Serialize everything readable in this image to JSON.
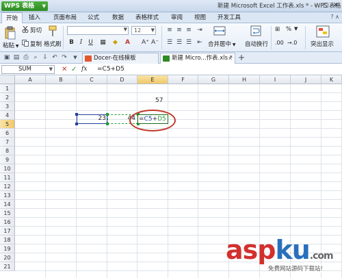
{
  "app": {
    "logo": "WPS 表格",
    "window_title": "新建 Microsoft Excel 工作表.xls * - WPS 表格"
  },
  "menu": {
    "tabs": [
      "开始",
      "插入",
      "页面布局",
      "公式",
      "数据",
      "表格样式",
      "审阅",
      "视图",
      "开发工具"
    ]
  },
  "ribbon": {
    "paste": "粘贴",
    "cut": "剪切",
    "copy": "复制",
    "format_painter": "格式刷",
    "font_size": "12",
    "merge_center": "合并居中",
    "wrap_text": "自动换行",
    "percent": "%",
    "highlight": "突出显示"
  },
  "tabs": {
    "docer": "Docer-在线模板",
    "workbook": "新建 Micro...作表.xls *"
  },
  "formula_bar": {
    "name_box": "SUM",
    "cancel": "✕",
    "confirm": "✓",
    "fx": "fx",
    "formula": "=C5+D5"
  },
  "sheet": {
    "columns": [
      "A",
      "B",
      "C",
      "D",
      "E",
      "F",
      "G",
      "H",
      "I",
      "J",
      "K"
    ],
    "rows": [
      "1",
      "2",
      "3",
      "4",
      "5",
      "6",
      "7",
      "8",
      "9",
      "10",
      "11",
      "12",
      "13",
      "14",
      "15",
      "16",
      "17",
      "18",
      "19",
      "20",
      "21"
    ],
    "active_column": "E",
    "active_row": "5",
    "cells": {
      "E3": "57",
      "C5": "23",
      "D5": "44"
    },
    "editing": {
      "eq": "=",
      "ref1": "C5",
      "op": "+",
      "ref2": "D5"
    }
  },
  "watermark": {
    "main_a": "asp",
    "main_b": "ku",
    "main_c": ".com",
    "sub": "免费网站源码下载站!"
  },
  "colors": {
    "accent": "#2e8b24",
    "ref1": "#1f3f9e",
    "ref2": "#2b9b3a",
    "annotation": "#c0392b"
  }
}
